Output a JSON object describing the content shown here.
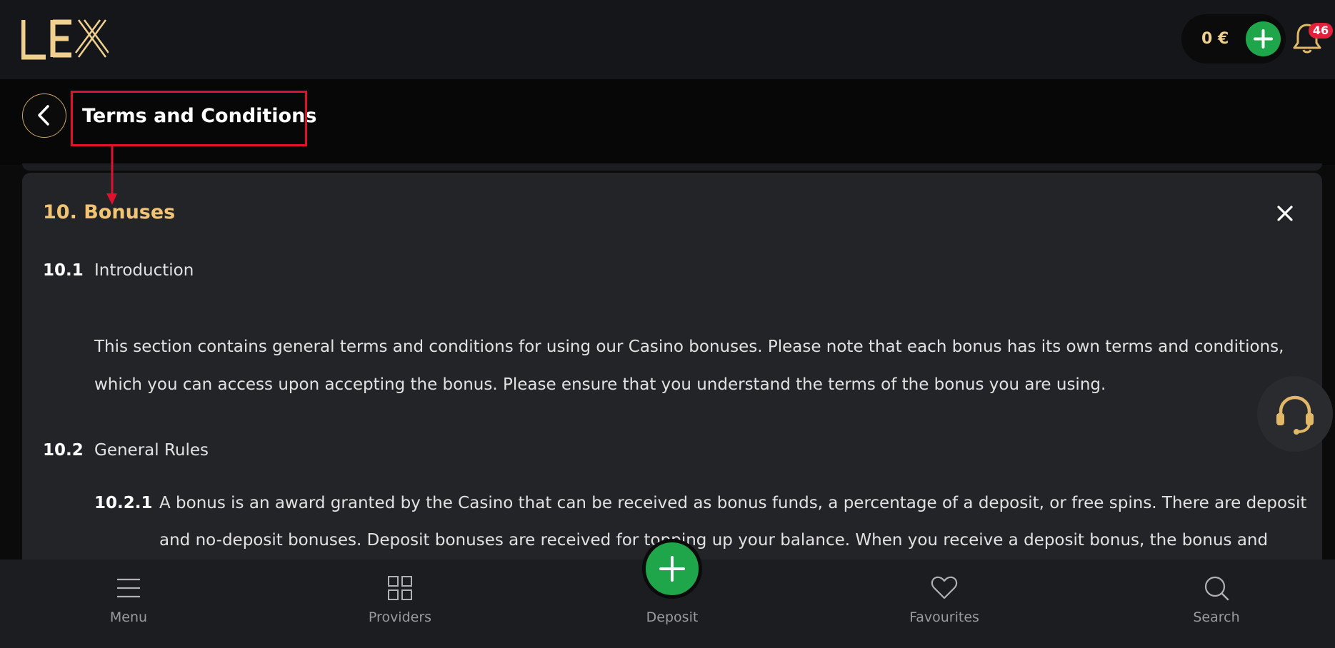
{
  "header": {
    "logo_text": "LEX",
    "balance": "0 €",
    "notifications_count": "46"
  },
  "subheader": {
    "title": "Terms and Conditions"
  },
  "section": {
    "title": "10. Bonuses",
    "items": [
      {
        "num": "10.1",
        "heading": "Introduction"
      },
      {
        "num": "10.2",
        "heading": "General Rules"
      }
    ],
    "intro_line1": "This section contains general terms and conditions for using our Casino bonuses. Please note that each bonus has its own terms and conditions,",
    "intro_line2": "which you can access upon accepting the bonus. Please ensure that you understand the terms of the bonus you are using.",
    "sub_num": "10.2.1",
    "sub_line1": "A bonus is an award granted by the Casino that can be received as bonus funds, a percentage of a deposit, or free spins. There are deposit",
    "sub_line2": "and no-deposit bonuses. Deposit bonuses are received for topping up your balance. When you receive a deposit bonus, the bonus and"
  },
  "bottom_nav": {
    "menu": "Menu",
    "providers": "Providers",
    "deposit": "Deposit",
    "favourites": "Favourites",
    "search": "Search"
  },
  "colors": {
    "accent_gold": "#f0c473",
    "deposit_green": "#1fa64b",
    "badge_red": "#e3213c",
    "callout_red": "#e0112d"
  }
}
